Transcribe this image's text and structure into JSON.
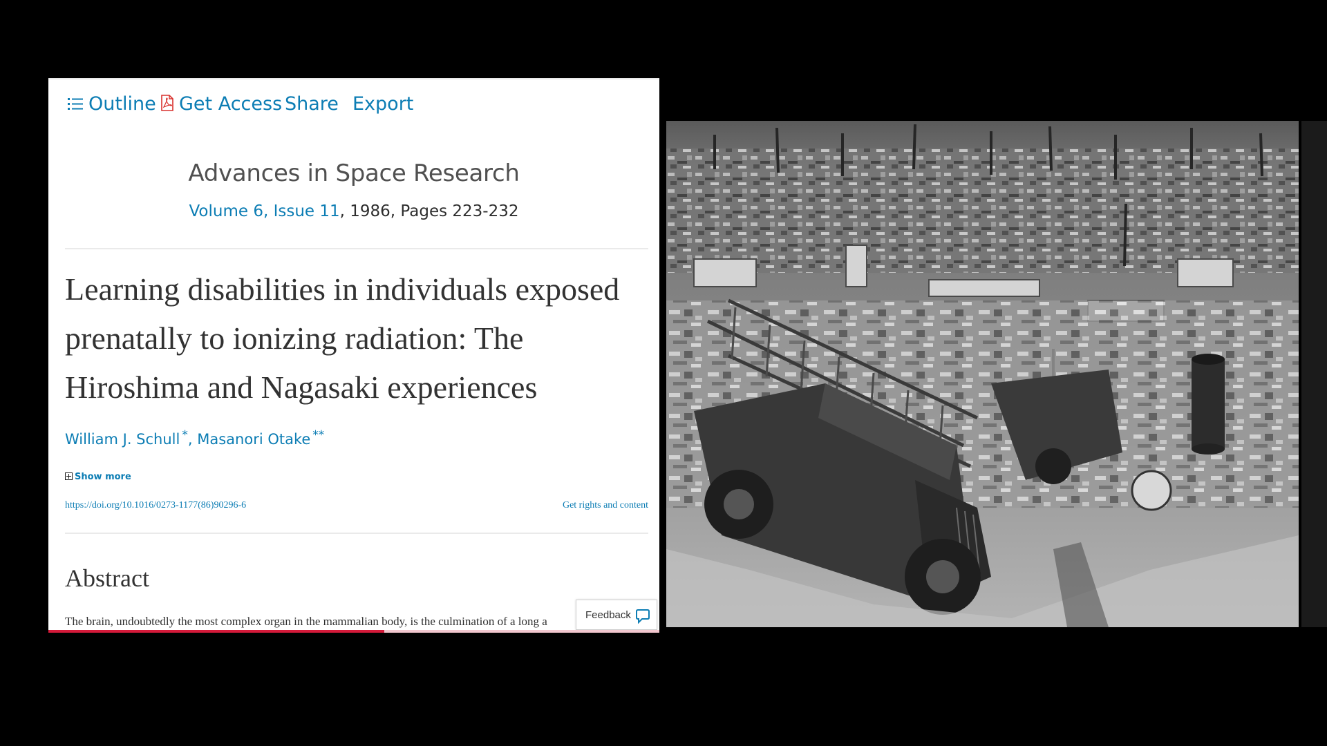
{
  "toolbar": {
    "outline": "Outline",
    "get_access": "Get Access",
    "share": "Share",
    "export": "Export"
  },
  "journal": {
    "name": "Advances in Space Research",
    "volume_issue": "Volume 6, Issue 11",
    "year_pages": ", 1986, Pages 223-232"
  },
  "article": {
    "title": "Learning disabilities in individuals exposed prenatally to ionizing radiation: The Hiroshima and Nagasaki experiences",
    "author1": "William J. Schull",
    "author1_mark": "*",
    "separator": ",",
    "author2": "Masanori Otake",
    "author2_mark": "**",
    "show_more": "Show more",
    "doi": "https://doi.org/10.1016/0273-1177(86)90296-6",
    "rights": "Get rights and content"
  },
  "abstract": {
    "heading": "Abstract",
    "text": "The brain, undoubtedly the most complex organ in the mammalian body, is the culmination of a long a"
  },
  "feedback": {
    "label": "Feedback"
  },
  "reading_progress": 0.55,
  "colors": {
    "link": "#0c7db4",
    "text": "#323232",
    "progress": "#d51a3a",
    "background": "#000000"
  },
  "icons": {
    "outline": "list-icon",
    "access": "pdf-icon",
    "feedback": "speech-bubble-icon"
  }
}
